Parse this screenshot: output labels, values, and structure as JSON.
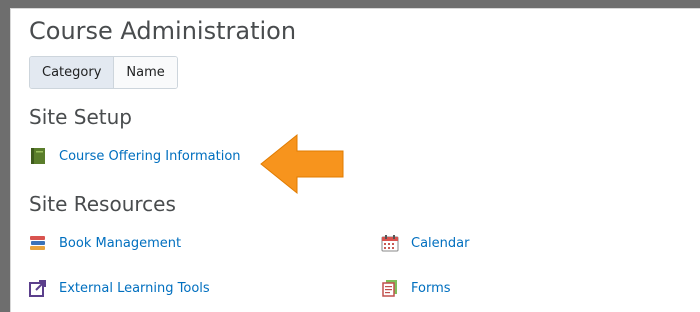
{
  "page": {
    "title": "Course Administration"
  },
  "view_toggle": {
    "options": [
      "Category",
      "Name"
    ],
    "selected": "Category"
  },
  "sections": [
    {
      "title": "Site Setup",
      "items": [
        {
          "label": "Course Offering Information",
          "icon": "green-book-icon"
        }
      ]
    },
    {
      "title": "Site Resources",
      "items": [
        {
          "label": "Book Management",
          "icon": "book-stack-icon"
        },
        {
          "label": "Calendar",
          "icon": "calendar-icon"
        },
        {
          "label": "External Learning Tools",
          "icon": "external-tool-icon"
        },
        {
          "label": "Forms",
          "icon": "forms-icon"
        }
      ]
    }
  ],
  "colors": {
    "link": "#006fbf",
    "heading": "#494c4e",
    "annotation_arrow": "#f7941d"
  }
}
